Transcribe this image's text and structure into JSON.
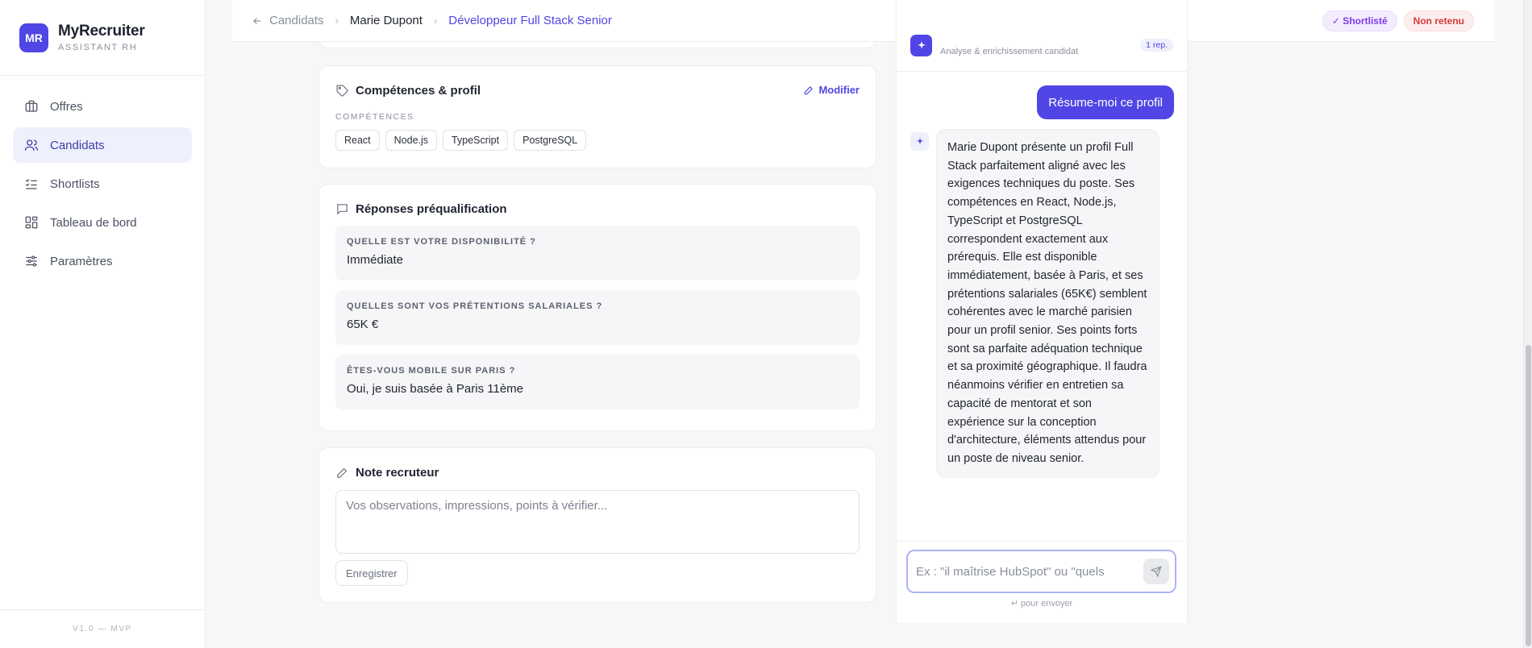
{
  "brand": {
    "logo": "MR",
    "name": "MyRecruiter",
    "subtitle": "ASSISTANT RH"
  },
  "sidebar": {
    "items": [
      {
        "label": "Offres",
        "icon": "briefcase-icon",
        "active": false
      },
      {
        "label": "Candidats",
        "icon": "users-icon",
        "active": true
      },
      {
        "label": "Shortlists",
        "icon": "list-check-icon",
        "active": false
      },
      {
        "label": "Tableau de bord",
        "icon": "dashboard-icon",
        "active": false
      },
      {
        "label": "Paramètres",
        "icon": "sliders-icon",
        "active": false
      }
    ],
    "version": "V1.0 — MVP"
  },
  "breadcrumb": {
    "back": "Candidats",
    "candidate": "Marie Dupont",
    "job": "Développeur Full Stack Senior"
  },
  "status": {
    "shortlisted": "✓ Shortlisté",
    "rejected": "Non retenu"
  },
  "skills": {
    "title": "Compétences & profil",
    "edit": "Modifier",
    "label": "COMPÉTENCES",
    "tags": [
      "React",
      "Node.js",
      "TypeScript",
      "PostgreSQL"
    ]
  },
  "prequal": {
    "title": "Réponses préqualification",
    "items": [
      {
        "q": "QUELLE EST VOTRE DISPONIBILITÉ ?",
        "a": "Immédiate"
      },
      {
        "q": "QUELLES SONT VOS PRÉTENTIONS SALARIALES ?",
        "a": "65K €"
      },
      {
        "q": "ÊTES-VOUS MOBILE SUR PARIS ?",
        "a": "Oui, je suis basée à Paris 11ème"
      }
    ]
  },
  "note": {
    "title": "Note recruteur",
    "placeholder": "Vos observations, impressions, points à vérifier...",
    "save": "Enregistrer"
  },
  "chat": {
    "subtitle": "Analyse & enrichissement candidat",
    "count": "1 rep.",
    "user_message": "Résume-moi ce profil",
    "bot_message": "Marie Dupont présente un profil Full Stack parfaitement aligné avec les exigences techniques du poste. Ses compétences en React, Node.js, TypeScript et PostgreSQL correspondent exactement aux prérequis. Elle est disponible immédiatement, basée à Paris, et ses prétentions salariales (65K€) semblent cohérentes avec le marché parisien pour un profil senior. Ses points forts sont sa parfaite adéquation technique et sa proximité géographique. Il faudra néanmoins vérifier en entretien sa capacité de mentorat et son expérience sur la conception d'architecture, éléments attendus pour un poste de niveau senior.",
    "input_placeholder": "Ex : \"il maîtrise HubSpot\" ou \"quels",
    "hint": "↵ pour envoyer"
  },
  "colors": {
    "accent": "#4f46e5",
    "shortlist": "#7c3aed",
    "reject": "#d23a3a"
  }
}
